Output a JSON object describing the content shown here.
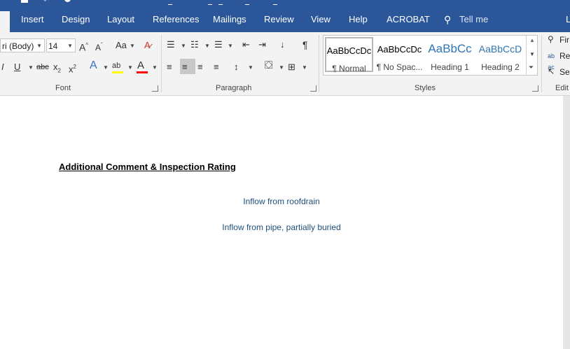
{
  "tabs": {
    "insert": "Insert",
    "design": "Design",
    "layout": "Layout",
    "references": "References",
    "mailings": "Mailings",
    "review": "Review",
    "view": "View",
    "help": "Help",
    "acrobat": "ACROBAT",
    "tell_me": "Tell me",
    "account_initial": "L"
  },
  "font": {
    "family": "ri (Body)",
    "size": "14",
    "group_label": "Font"
  },
  "paragraph": {
    "group_label": "Paragraph"
  },
  "styles": {
    "group_label": "Styles",
    "items": [
      {
        "sample": "AaBbCcDc",
        "name": "¶ Normal"
      },
      {
        "sample": "AaBbCcDc",
        "name": "¶ No Spac..."
      },
      {
        "sample": "AaBbCc",
        "name": "Heading 1"
      },
      {
        "sample": "AaBbCcD",
        "name": "Heading 2"
      }
    ]
  },
  "editing": {
    "group_label": "Edit",
    "find": "Fir",
    "replace": "Re",
    "select": "Sel"
  },
  "document": {
    "heading": "Additional Comment & Inspection Rating",
    "lines": [
      "Inflow from roofdrain",
      "Inflow from pipe, partially buried"
    ]
  },
  "colors": {
    "ribbon_blue": "#2b579a",
    "highlight_yellow": "#ffff00",
    "font_color_red": "#ff0000",
    "heading1_blue": "#2e74b5",
    "body_text_blue": "#1f4e79"
  }
}
